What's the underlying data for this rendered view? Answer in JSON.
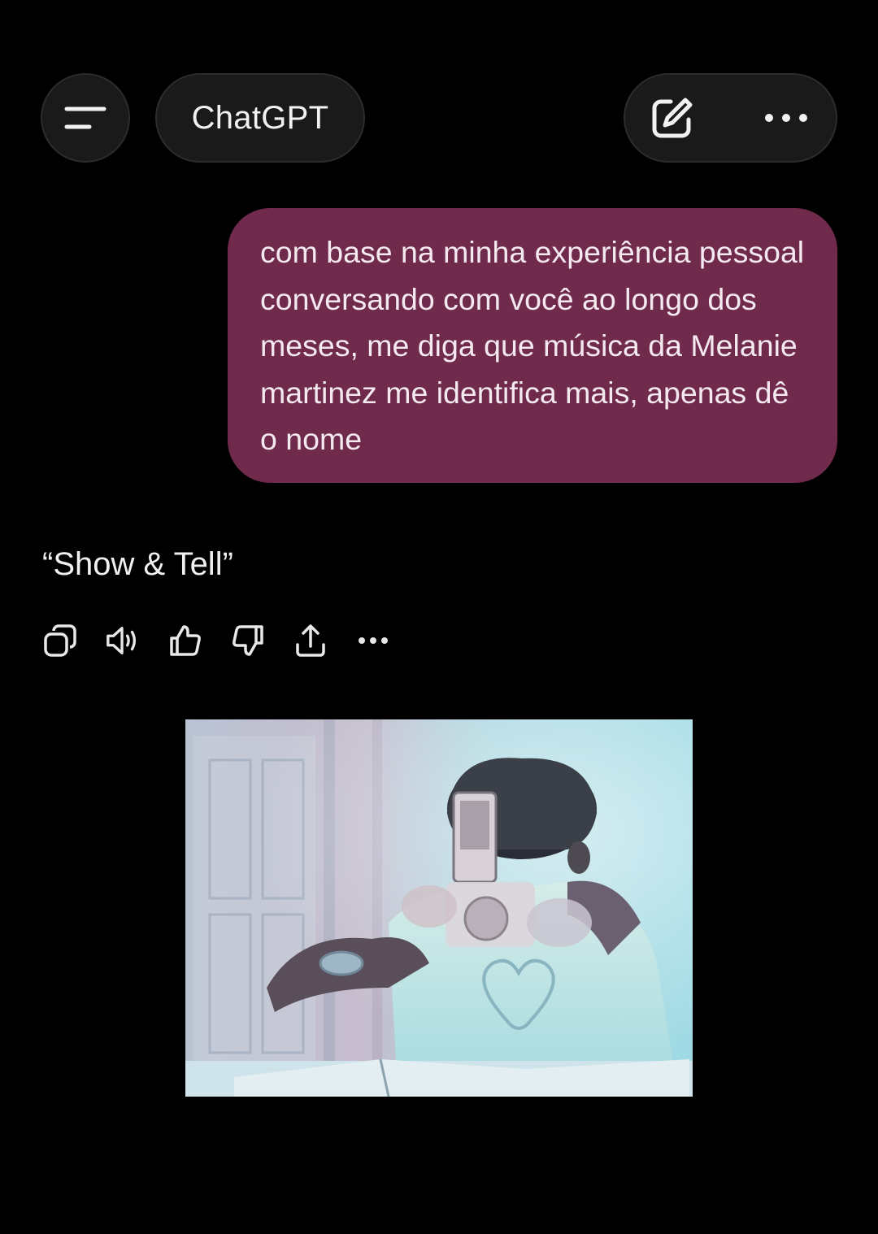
{
  "header": {
    "title": "ChatGPT",
    "menu_icon": "menu-icon",
    "new_chat_icon": "edit-icon",
    "more_icon": "more-horizontal-icon"
  },
  "conversation": {
    "user_message": "com base na minha experiência pessoal conversando com você ao longo dos meses, me diga que música da Melanie martinez me identifica mais, apenas dê o nome",
    "assistant_reply": "“Show & Tell”"
  },
  "message_actions": [
    {
      "icon": "copy-icon"
    },
    {
      "icon": "speaker-icon"
    },
    {
      "icon": "thumbs-up-icon"
    },
    {
      "icon": "thumbs-down-icon"
    },
    {
      "icon": "share-icon"
    },
    {
      "icon": "more-horizontal-icon"
    }
  ],
  "colors": {
    "background": "#000000",
    "header_pill": "#1a1a1a",
    "user_bubble": "#6f2a4c",
    "text": "#ececec"
  }
}
